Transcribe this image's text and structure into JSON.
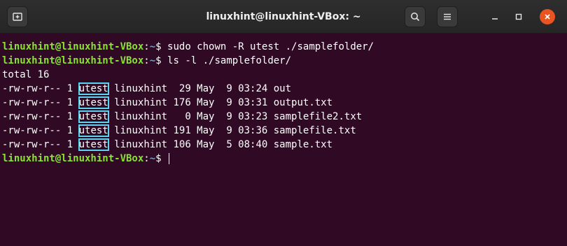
{
  "window": {
    "title": "linuxhint@linuxhint-VBox: ~",
    "new_tab_icon": "new-tab-icon",
    "search_icon": "search-icon",
    "menu_icon": "hamburger-menu-icon",
    "minimize_icon": "minimize-icon",
    "maximize_icon": "maximize-icon",
    "close_icon": "close-icon",
    "accent_close": "#e95420"
  },
  "terminal": {
    "colors": {
      "background": "#300a24",
      "prompt_user": "#8ae234",
      "prompt_path": "#729fcf",
      "highlight_box": "#5bd6f0"
    },
    "prompt": {
      "user_host": "linuxhint@linuxhint-VBox",
      "colon": ":",
      "path": "~",
      "symbol": "$ "
    },
    "commands": [
      "sudo chown -R utest ./samplefolder/",
      "ls -l ./samplefolder/"
    ],
    "total": "total 16",
    "listing": [
      {
        "perm": "-rw-rw-r--",
        "links": " 1 ",
        "owner": "utest",
        "rest": " linuxhint  29 May  9 03:24 out"
      },
      {
        "perm": "-rw-rw-r--",
        "links": " 1 ",
        "owner": "utest",
        "rest": " linuxhint 176 May  9 03:31 output.txt"
      },
      {
        "perm": "-rw-rw-r--",
        "links": " 1 ",
        "owner": "utest",
        "rest": " linuxhint   0 May  9 03:23 samplefile2.txt"
      },
      {
        "perm": "-rw-rw-r--",
        "links": " 1 ",
        "owner": "utest",
        "rest": " linuxhint 191 May  9 03:36 samplefile.txt"
      },
      {
        "perm": "-rw-rw-r--",
        "links": " 1 ",
        "owner": "utest",
        "rest": " linuxhint 106 May  5 08:40 sample.txt"
      }
    ]
  }
}
